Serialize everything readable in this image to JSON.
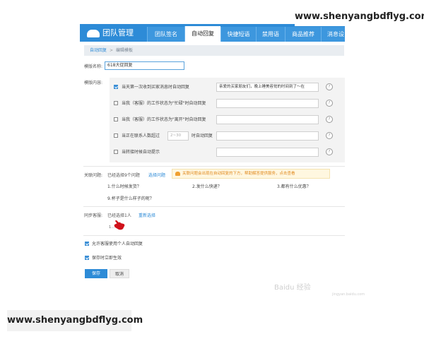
{
  "watermarks": {
    "top": "www.shenyangbdflyg.com",
    "bottom": "www.shenyangbdflyg.com",
    "baidu": "Baidu 经验",
    "baidu_sub": "jingyan.baidu.com"
  },
  "nav": {
    "logo": "团队管理",
    "tabs": [
      "团队签名",
      "自动回复",
      "快捷短语",
      "禁用语",
      "商品推荐",
      "消息设"
    ],
    "active_index": 1
  },
  "breadcrumb": {
    "parent": "自动回复",
    "current": "编辑模板"
  },
  "form": {
    "name_label": "模版名称:",
    "name_value": "618大促回复",
    "content_label": "模版内容:",
    "options": [
      {
        "checked": true,
        "text": "当天第一次收到买家消息时自动回复",
        "value": "亲爱的买家朋友们，晚上睡美容觉的时间到了～在",
        "help": "?"
      },
      {
        "checked": false,
        "text": "当我（客服）的工作状态为\"忙碌\"时自动回复",
        "value": "",
        "help": "?"
      },
      {
        "checked": false,
        "text": "当我（客服）的工作状态为\"离开\"时自动回复",
        "value": "",
        "help": "?"
      },
      {
        "checked": false,
        "text": "当正在联系人数超过",
        "num_placeholder": "2~30",
        "after": "时自动回复",
        "value": "",
        "help": "?"
      },
      {
        "checked": false,
        "text": "当转接时候自动提示",
        "value": "",
        "help": "?"
      }
    ],
    "related_label": "关联问题:",
    "related_selected": "已经选择9个问题",
    "related_link": "选择问题",
    "notice": "关联问题会出现在自动回复的下方，帮助解答提供服务，点击查看",
    "questions": [
      "1.什么时候发货？",
      "2.发什么快递？",
      "3.都有什么优惠？",
      "9.杯子是什么样子的呢？"
    ],
    "sync_label": "同步客服:",
    "sync_selected": "已经选择1人",
    "sync_link": "重新选择",
    "sync_person": "1...",
    "allow_personal": {
      "checked": true,
      "text": "允许客服使用个人自动回复"
    },
    "effective_now": {
      "checked": true,
      "text": "保存时立即生效"
    },
    "save": "保存",
    "cancel": "取消"
  }
}
